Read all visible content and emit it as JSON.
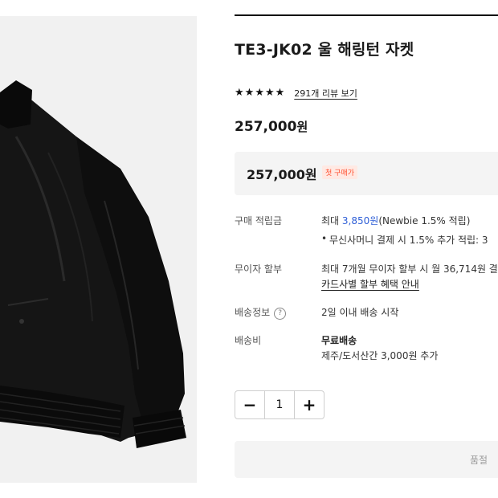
{
  "product": {
    "title": "TE3-JK02 울 해링턴 자켓",
    "stars": [
      "★",
      "★",
      "★",
      "★",
      "★"
    ],
    "review_link": "291개 리뷰 보기",
    "price_amount": "257,000",
    "price_unit": "원"
  },
  "discount": {
    "price": "257,000원",
    "badge": "첫 구매가"
  },
  "points": {
    "label": "구매 적립금",
    "prefix": "최대 ",
    "amount": "3,850원",
    "suffix": "(Newbie 1.5% 적립)",
    "bullet": "무신사머니 결제 시 1.5% 추가 적립: 3"
  },
  "installment": {
    "label": "무이자 할부",
    "value": "최대 7개월 무이자 할부 시 월 36,714원 결",
    "link": "카드사별 할부 혜택 안내"
  },
  "shipping_info": {
    "label": "배송정보",
    "help_icon": "?",
    "value": "2일 이내 배송 시작"
  },
  "shipping_fee": {
    "label": "배송비",
    "value": "무료배송",
    "extra": "제주/도서산간 3,000원 추가"
  },
  "quantity": {
    "minus": "−",
    "value": "1",
    "plus": "+"
  },
  "soldout_button": {
    "label": "품절"
  },
  "colors": {
    "accent": "#2f5fd7",
    "badge_text": "#ff4d2d",
    "badge_bg": "#ffe9e3",
    "panel_bg": "#f4f4f4"
  }
}
